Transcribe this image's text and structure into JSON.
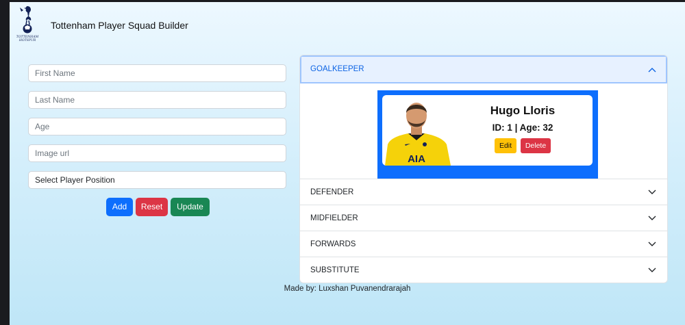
{
  "header": {
    "title": "Tottenham Player Squad Builder",
    "logo_text_line1": "TOTTENHAM",
    "logo_text_line2": "HOTSPUR"
  },
  "form": {
    "first_name_placeholder": "First Name",
    "last_name_placeholder": "Last Name",
    "age_placeholder": "Age",
    "image_url_placeholder": "Image url",
    "position_select_value": "Select Player Position",
    "add_label": "Add",
    "reset_label": "Reset",
    "update_label": "Update"
  },
  "accordion": {
    "sections": [
      {
        "label": "GOALKEEPER",
        "expanded": true
      },
      {
        "label": "DEFENDER",
        "expanded": false
      },
      {
        "label": "MIDFIELDER",
        "expanded": false
      },
      {
        "label": "FORWARDS",
        "expanded": false
      },
      {
        "label": "SUBSTITUTE",
        "expanded": false
      }
    ]
  },
  "goalkeeper_card": {
    "name": "Hugo Lloris",
    "meta": "ID: 1 | Age: 32",
    "shirt_sponsor": "AIA",
    "edit_label": "Edit",
    "delete_label": "Delete"
  },
  "footer": {
    "text": "Made by: Luxshan Puvanendrarajah"
  },
  "colors": {
    "primary": "#0d6efd",
    "danger": "#dc3545",
    "success": "#198754",
    "warning": "#ffc107",
    "accordion_active_bg": "#e7f1ff",
    "accordion_active_text": "#0c63e4"
  }
}
